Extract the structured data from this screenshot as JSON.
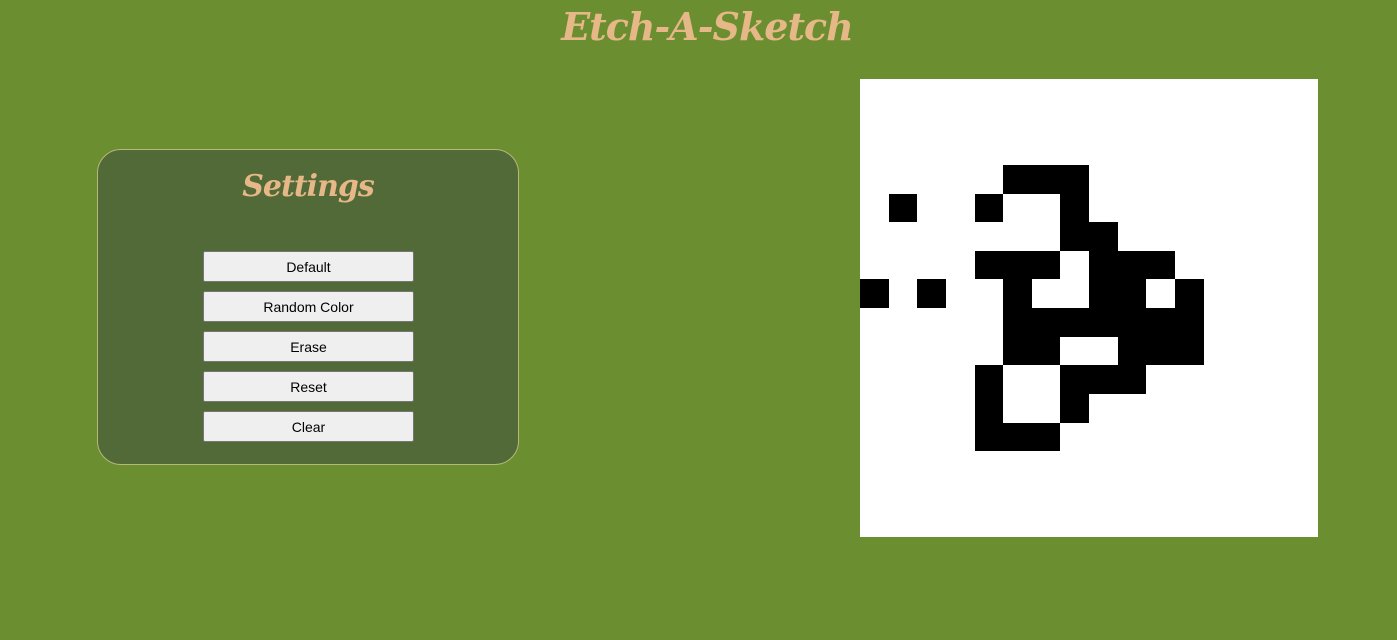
{
  "header": {
    "title": "Etch-A-Sketch"
  },
  "settings": {
    "title": "Settings",
    "buttons": [
      {
        "label": "Default"
      },
      {
        "label": "Random Color"
      },
      {
        "label": "Erase"
      },
      {
        "label": "Reset"
      },
      {
        "label": "Clear"
      }
    ]
  },
  "sketch": {
    "grid_size": 16,
    "background_color": "#ffffff",
    "pen_color": "#000000",
    "filled_cells": [
      [
        3,
        5
      ],
      [
        3,
        6
      ],
      [
        3,
        7
      ],
      [
        4,
        1
      ],
      [
        4,
        4
      ],
      [
        4,
        7
      ],
      [
        5,
        7
      ],
      [
        5,
        8
      ],
      [
        6,
        4
      ],
      [
        6,
        5
      ],
      [
        6,
        6
      ],
      [
        6,
        8
      ],
      [
        6,
        9
      ],
      [
        6,
        10
      ],
      [
        7,
        0
      ],
      [
        7,
        2
      ],
      [
        7,
        5
      ],
      [
        7,
        8
      ],
      [
        7,
        9
      ],
      [
        7,
        11
      ],
      [
        8,
        5
      ],
      [
        8,
        6
      ],
      [
        8,
        7
      ],
      [
        8,
        8
      ],
      [
        8,
        9
      ],
      [
        8,
        10
      ],
      [
        8,
        11
      ],
      [
        9,
        5
      ],
      [
        9,
        6
      ],
      [
        9,
        9
      ],
      [
        9,
        10
      ],
      [
        9,
        11
      ],
      [
        10,
        4
      ],
      [
        10,
        7
      ],
      [
        10,
        8
      ],
      [
        10,
        9
      ],
      [
        11,
        4
      ],
      [
        11,
        7
      ],
      [
        12,
        4
      ],
      [
        12,
        5
      ],
      [
        12,
        6
      ]
    ]
  },
  "colors": {
    "page_background": "#6b8e31",
    "panel_background": "#526a37",
    "title_color": "#e6b887"
  }
}
